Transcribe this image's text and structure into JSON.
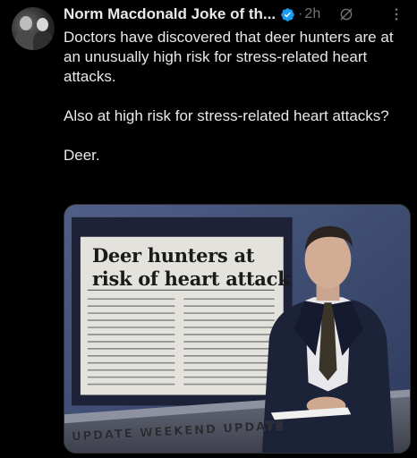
{
  "post": {
    "author_name": "Norm Macdonald Joke of th...",
    "separator": "·",
    "timestamp": "2h",
    "paragraphs": [
      "Doctors have discovered that deer hunters are at an unusually high risk for stress-related heart attacks.",
      "Also at high risk for stress-related heart attacks?",
      "Deer."
    ]
  },
  "media": {
    "headline_line1": "Deer hunters at",
    "headline_line2": "risk of heart attack",
    "desk_text": "UPDATE WEEKEND UPDATE"
  },
  "icons": {
    "verified": "verified-badge-icon",
    "grok": "grok-icon",
    "more": "more-options-icon"
  },
  "colors": {
    "background": "#000000",
    "text": "#e7e9ea",
    "muted": "#71767b",
    "verified": "#1d9bf0"
  }
}
